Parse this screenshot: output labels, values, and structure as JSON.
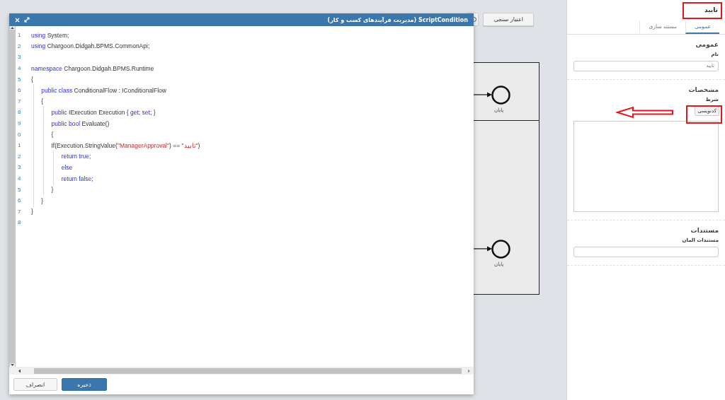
{
  "toolbar": {
    "validate_button": "اعتبار سنجی"
  },
  "diagram": {
    "end_events": [
      {
        "label": "پایان"
      },
      {
        "label": "پایان"
      }
    ]
  },
  "dialog": {
    "title": "ScriptCondition (مدیریت فرآیندهای کسب و کار)",
    "lines": [
      {
        "number": "1",
        "code": "*using* System;"
      },
      {
        "number": "2",
        "code": "*using* Chargoon.Didgah.BPMS.CommonApi;"
      },
      {
        "number": "3"
      },
      {
        "number": "4",
        "code": "*namespace* Chargoon.Didgah.BPMS.Runtime"
      },
      {
        "number": "5",
        "code": "{"
      },
      {
        "number": "6",
        "code": "    *public class* ConditionalFlow : IConditionalFlow"
      },
      {
        "number": "7",
        "code": "    {"
      },
      {
        "number": "8",
        "code": "        *public* IExecution Execution { *get*; *set*; }"
      },
      {
        "number": "9",
        "code": "        *public bool* Evaluate()"
      },
      {
        "number": "0",
        "code": "        {"
      },
      {
        "number": "1",
        "code": "        If(Execution.StringValue(**\"ManagerApproval\"**) == **\"تایید\"**)"
      },
      {
        "number": "2",
        "code": "            *return true;*"
      },
      {
        "number": "3",
        "code": "            *else*"
      },
      {
        "number": "4",
        "code": "            *return false;*"
      },
      {
        "number": "5",
        "code": "        }"
      },
      {
        "number": "6",
        "code": "    }"
      },
      {
        "number": "7",
        "code": "}"
      },
      {
        "number": "8"
      }
    ],
    "buttons": [
      {
        "label": "ذخیره",
        "primary": true
      },
      {
        "label": "انصراف",
        "primary": false
      }
    ]
  },
  "properties_panel": {
    "title": "تایید",
    "tabs": [
      {
        "label": "عمومی",
        "selected": true
      },
      {
        "label": "مستند سازی",
        "selected": false
      }
    ],
    "sections": [
      {
        "heading": "عمومی",
        "fields": [
          {
            "kind": "input",
            "label": "نام",
            "value": "تایید"
          }
        ]
      },
      {
        "heading": "مشخصات",
        "fields": [
          {
            "kind": "script",
            "label": "شرط",
            "button": "کدنویسی"
          }
        ]
      },
      {
        "heading": "مستندات",
        "fields": [
          {
            "kind": "input",
            "label": "مستندات المان"
          }
        ]
      }
    ]
  }
}
